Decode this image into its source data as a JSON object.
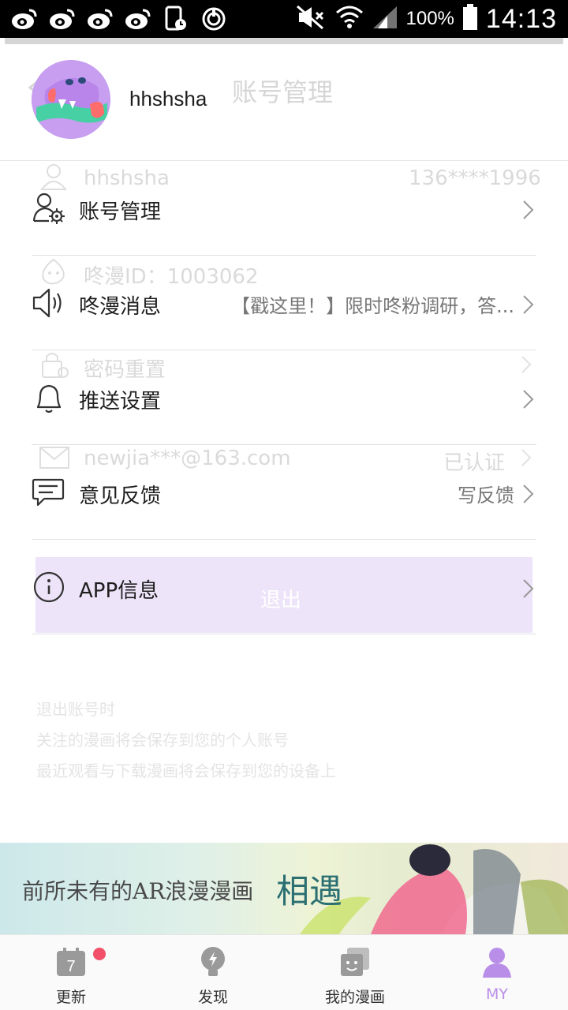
{
  "status_bar": {
    "battery": "100%",
    "time": "14:13",
    "left_icons": [
      "weibo-icon",
      "weibo-icon",
      "weibo-icon",
      "weibo-icon",
      "phone-clock-icon",
      "power-ring-icon"
    ],
    "right_icons": [
      "mute-icon",
      "wifi-icon",
      "signal-icon",
      "battery-icon"
    ]
  },
  "ghost_page": {
    "title": "账号管理",
    "rows": [
      {
        "label": "hhshsha",
        "value": "136****1996"
      },
      {
        "label": "咚漫ID：1003062",
        "value": ""
      },
      {
        "label": "密码重置",
        "value": ""
      },
      {
        "label": "newjia***@163.com",
        "value": "已认证"
      }
    ],
    "logout": "退出",
    "notes": [
      "退出账号时",
      "关注的漫画将会保存到您的个人账号",
      "最近观看与下载漫画将会保存到您的设备上"
    ]
  },
  "profile": {
    "username": "hhshsha"
  },
  "menu": [
    {
      "label": "账号管理",
      "value": "",
      "icon": "account-settings-icon"
    },
    {
      "label": "咚漫消息",
      "value": "【戳这里！】限时咚粉调研，答...",
      "icon": "speaker-icon"
    },
    {
      "label": "推送设置",
      "value": "",
      "icon": "bell-icon"
    },
    {
      "label": "意见反馈",
      "value": "写反馈",
      "icon": "feedback-icon"
    },
    {
      "label": "APP信息",
      "value": "",
      "icon": "info-icon"
    }
  ],
  "banner": {
    "text": "前所未有的AR浪漫漫画",
    "highlight": "相遇"
  },
  "tabs": [
    {
      "label": "更新",
      "icon": "calendar-icon",
      "badge": "7",
      "has_dot": true
    },
    {
      "label": "发现",
      "icon": "bulb-icon"
    },
    {
      "label": "我的漫画",
      "icon": "comic-stack-icon"
    },
    {
      "label": "MY",
      "icon": "person-icon",
      "active": true
    }
  ],
  "colors": {
    "accent": "#b98ee8",
    "badge": "#f2506a",
    "divider": "#e0e0e0"
  }
}
